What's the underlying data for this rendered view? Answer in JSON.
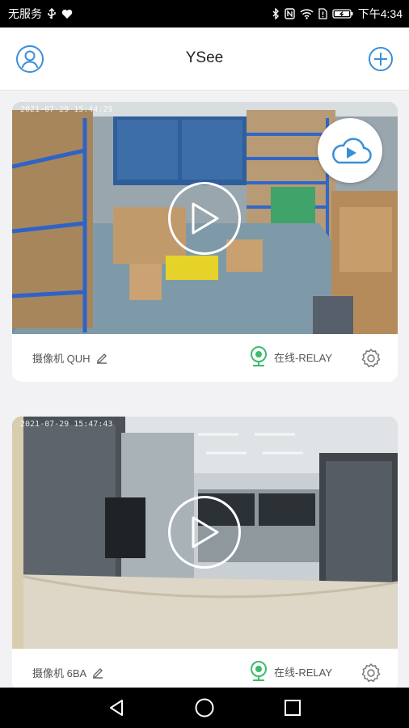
{
  "status_bar": {
    "left_text": "无服务",
    "time": "下午4:34"
  },
  "header": {
    "title": "YSee"
  },
  "cameras": [
    {
      "timestamp": "2021-07-29 15:44:29",
      "name": "摄像机 QUH",
      "status": "在线-RELAY"
    },
    {
      "timestamp": "2021-07-29 15:47:43",
      "name": "摄像机 6BA",
      "status": "在线-RELAY"
    }
  ],
  "colors": {
    "accent_blue": "#3a8fd9",
    "online_green": "#3dbb6b"
  },
  "icons": {
    "profile": "user-icon",
    "add": "plus-circle-icon",
    "cloud": "cloud-play-icon",
    "edit": "pencil-icon",
    "online": "webcam-icon",
    "settings": "gear-icon"
  }
}
